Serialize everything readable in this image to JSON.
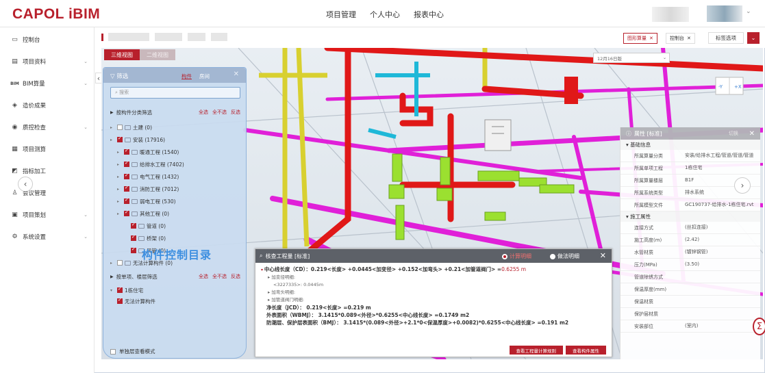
{
  "header": {
    "logo": "CAPOL iBIM",
    "nav": [
      "项目管理",
      "个人中心",
      "报表中心"
    ]
  },
  "sidebar": {
    "items": [
      {
        "label": "控制台",
        "icon": "monitor-icon",
        "chevron": false
      },
      {
        "label": "项目资料",
        "icon": "doc-icon",
        "chevron": true
      },
      {
        "label": "BIM算量",
        "icon": "bim-icon",
        "chevron": true
      },
      {
        "label": "造价成果",
        "icon": "money-icon",
        "chevron": false
      },
      {
        "label": "质控检查",
        "icon": "check-icon",
        "chevron": true
      },
      {
        "label": "项目测算",
        "icon": "calc-icon",
        "chevron": false
      },
      {
        "label": "指标加工",
        "icon": "index-icon",
        "chevron": false
      },
      {
        "label": "会议管理",
        "icon": "meeting-icon",
        "chevron": false
      },
      {
        "label": "项目策划",
        "icon": "plan-icon",
        "chevron": true
      },
      {
        "label": "系统设置",
        "icon": "settings-icon",
        "chevron": true
      }
    ]
  },
  "tabs": {
    "items": [
      "图形算量",
      "控制台"
    ],
    "options_label": "标签选项"
  },
  "viewer": {
    "view_tabs": [
      "三维视图",
      "二维视图"
    ],
    "date_select": "12月16日版",
    "cube_faces": [
      "-Y",
      "+X"
    ]
  },
  "filter": {
    "title": "筛选",
    "tab_component": "构件",
    "tab_space": "房间",
    "search_placeholder": "搜索",
    "section1": "按构件分类筛选",
    "actions": [
      "全选",
      "全不选",
      "反选"
    ],
    "tree": [
      {
        "label": "土建 (0)",
        "level": 0,
        "checked": false
      },
      {
        "label": "安装 (17916)",
        "level": 0,
        "checked": true
      },
      {
        "label": "暖通工程 (1540)",
        "level": 1,
        "checked": true
      },
      {
        "label": "给排水工程 (7402)",
        "level": 1,
        "checked": true
      },
      {
        "label": "电气工程 (1432)",
        "level": 1,
        "checked": true
      },
      {
        "label": "消防工程 (7012)",
        "level": 1,
        "checked": true
      },
      {
        "label": "弱电工程 (530)",
        "level": 1,
        "checked": true
      },
      {
        "label": "其他工程 (0)",
        "level": 1,
        "checked": true
      },
      {
        "label": "管道 (0)",
        "level": 2,
        "checked": true
      },
      {
        "label": "桥架 (0)",
        "level": 2,
        "checked": true
      },
      {
        "label": "风管 (0)",
        "level": 2,
        "checked": true
      },
      {
        "label": "无法计算构件 (0)",
        "level": 0,
        "checked": false
      }
    ],
    "section2": "按单项、楼层筛选",
    "floors": [
      {
        "label": "1栋住宅",
        "checked": true
      },
      {
        "label": "无法计算构件",
        "checked": true
      }
    ],
    "overlay_label": "构件控制目录",
    "footer": "单独层查看模式"
  },
  "props": {
    "title": "属性 [标准]",
    "switch_label": "切换",
    "group1": "基础信息",
    "rows1": [
      {
        "k": "所属算量分类",
        "v": "安装/给排水工程/管道/管道/管道"
      },
      {
        "k": "所属单项工程",
        "v": "1栋住宅"
      },
      {
        "k": "所属算量楼层",
        "v": "B1F"
      },
      {
        "k": "所属系统类型",
        "v": "排水系统"
      },
      {
        "k": "所属模型文件",
        "v": "GC190737-给排水-1栋住宅.rvt"
      }
    ],
    "group2": "施工属性",
    "rows2": [
      {
        "k": "连接方式",
        "v": "(丝扣连接)"
      },
      {
        "k": "施工高度(m)",
        "v": "(2.42)"
      },
      {
        "k": "水管材质",
        "v": "(镀锌钢管)"
      },
      {
        "k": "压力(MPa)",
        "v": "(3.50)"
      },
      {
        "k": "管道除锈方式",
        "v": ""
      },
      {
        "k": "保温厚度(mm)",
        "v": ""
      },
      {
        "k": "保温材质",
        "v": ""
      },
      {
        "k": "保护层材质",
        "v": ""
      },
      {
        "k": "安装部位",
        "v": "(室内)"
      }
    ]
  },
  "qpanel": {
    "title": "核查工程量 [标准]",
    "opt_calc": "计算明细",
    "opt_method": "做法明细",
    "line_main": "中心线长度（CD）：0.219<长度> +0.0445<加变径> +0.152<加弯头> +0.21<加管道阀门> =",
    "line_main_result": "0.6255 m",
    "sub1": "加变径明细:",
    "sub1_detail": "<3227335>: 0.0445m",
    "sub2": "加弯头明细:",
    "sub3": "加管道阀门明细:",
    "line_jcd": "净长度（JCD）：  0.219<长度> =0.219 m",
    "line_wbmj": "外表面积（WBMJ）：  3.1415*0.089<外径>*0.6255<中心线长度> =0.1749 m2",
    "line_bmj": "防潮层、保护层表面积（BMJ）：  3.1415*(0.089<外径>+2.1*0<保温厚度>+0.0082)*0.6255<中心线长度> =0.191 m2",
    "btn_rules": "查看工程量计算规则",
    "btn_attrs": "查看构件属性"
  },
  "colors": {
    "brand": "#b8202c",
    "magenta_pipe": "#e020d8",
    "red_pipe": "#e01818",
    "yellow_pipe": "#d8d030",
    "green_valve": "#9be030"
  }
}
